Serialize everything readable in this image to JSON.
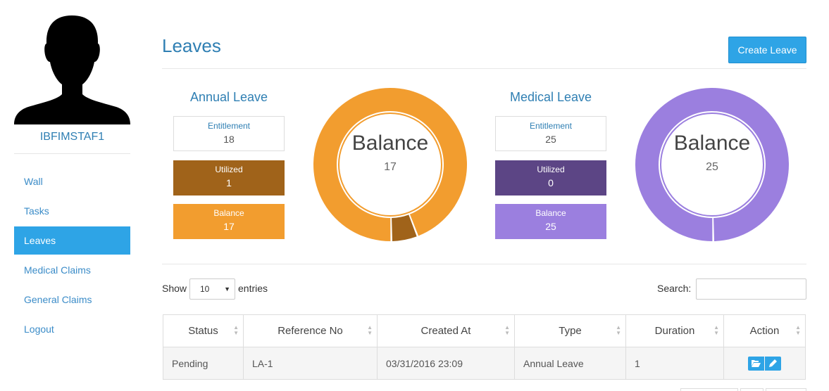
{
  "user": {
    "name": "IBFIMSTAF1"
  },
  "nav": {
    "items": [
      {
        "label": "Wall"
      },
      {
        "label": "Tasks"
      },
      {
        "label": "Leaves"
      },
      {
        "label": "Medical Claims"
      },
      {
        "label": "General Claims"
      },
      {
        "label": "Logout"
      }
    ],
    "active_index": 2
  },
  "header": {
    "title": "Leaves",
    "create_label": "Create Leave"
  },
  "annual": {
    "title": "Annual Leave",
    "entitlement_label": "Entitlement",
    "entitlement": "18",
    "utilized_label": "Utilized",
    "utilized": "1",
    "balance_label": "Balance",
    "balance": "17",
    "chart_label": "Balance",
    "chart_value": "17",
    "colors": {
      "utilized": "#a0631a",
      "balance": "#f29d2f"
    }
  },
  "medical": {
    "title": "Medical Leave",
    "entitlement_label": "Entitlement",
    "entitlement": "25",
    "utilized_label": "Utilized",
    "utilized": "0",
    "balance_label": "Balance",
    "balance": "25",
    "chart_label": "Balance",
    "chart_value": "25",
    "colors": {
      "utilized": "#5c4585",
      "balance": "#9b7fdf"
    }
  },
  "table": {
    "show_label": "Show",
    "page_size": "10",
    "entries_label": "entries",
    "search_label": "Search:",
    "search_value": "",
    "columns": [
      "Status",
      "Reference No",
      "Created At",
      "Type",
      "Duration",
      "Action"
    ],
    "rows": [
      {
        "status": "Pending",
        "reference": "LA-1",
        "created_at": "03/31/2016 23:09",
        "type": "Annual Leave",
        "duration": "1"
      }
    ]
  }
}
